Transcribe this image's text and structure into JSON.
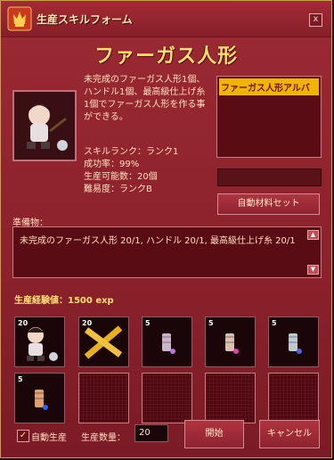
{
  "window": {
    "title": "生産スキルフォーム",
    "close_label": "x"
  },
  "item": {
    "name": "ファーガス人形",
    "description": "未完成のファーガス人形1個、ハンドル1個、最高級仕上げ糸1個でファーガス人形を作る事ができる。",
    "selected_recipe": "ファーガス人形アルバ"
  },
  "stats": {
    "skill_rank": "スキルランク：ランク1",
    "success_rate": "成功率：99%",
    "producible": "生産可能数：20個",
    "difficulty": "難易度：ランクB"
  },
  "buttons": {
    "auto_material_set": "自動材料セット",
    "start": "開始",
    "cancel": "キャンセル"
  },
  "preparation": {
    "label": "準備物：",
    "text": "未完成のファーガス人形 20/1, ハンドル 20/1, 最高級仕上げ糸 20/1"
  },
  "exp": {
    "label": "生産経験値：1500 exp"
  },
  "inventory": {
    "slots": [
      {
        "count": "20",
        "icon": "fergus-doll-icon"
      },
      {
        "count": "20",
        "icon": "handle-icon"
      },
      {
        "count": "5",
        "icon": "thread-icon"
      },
      {
        "count": "5",
        "icon": "thread-icon"
      },
      {
        "count": "5",
        "icon": "thread-icon"
      },
      {
        "count": "5",
        "icon": "thread-icon"
      }
    ]
  },
  "footer": {
    "auto_production_label": "自動生産",
    "auto_production_checked": true,
    "quantity_label": "生産数量：",
    "quantity_value": "20"
  },
  "colors": {
    "window_bg": "#8a212b",
    "heading": "#ffe070",
    "selected_recipe_bg": "#f2b400"
  }
}
